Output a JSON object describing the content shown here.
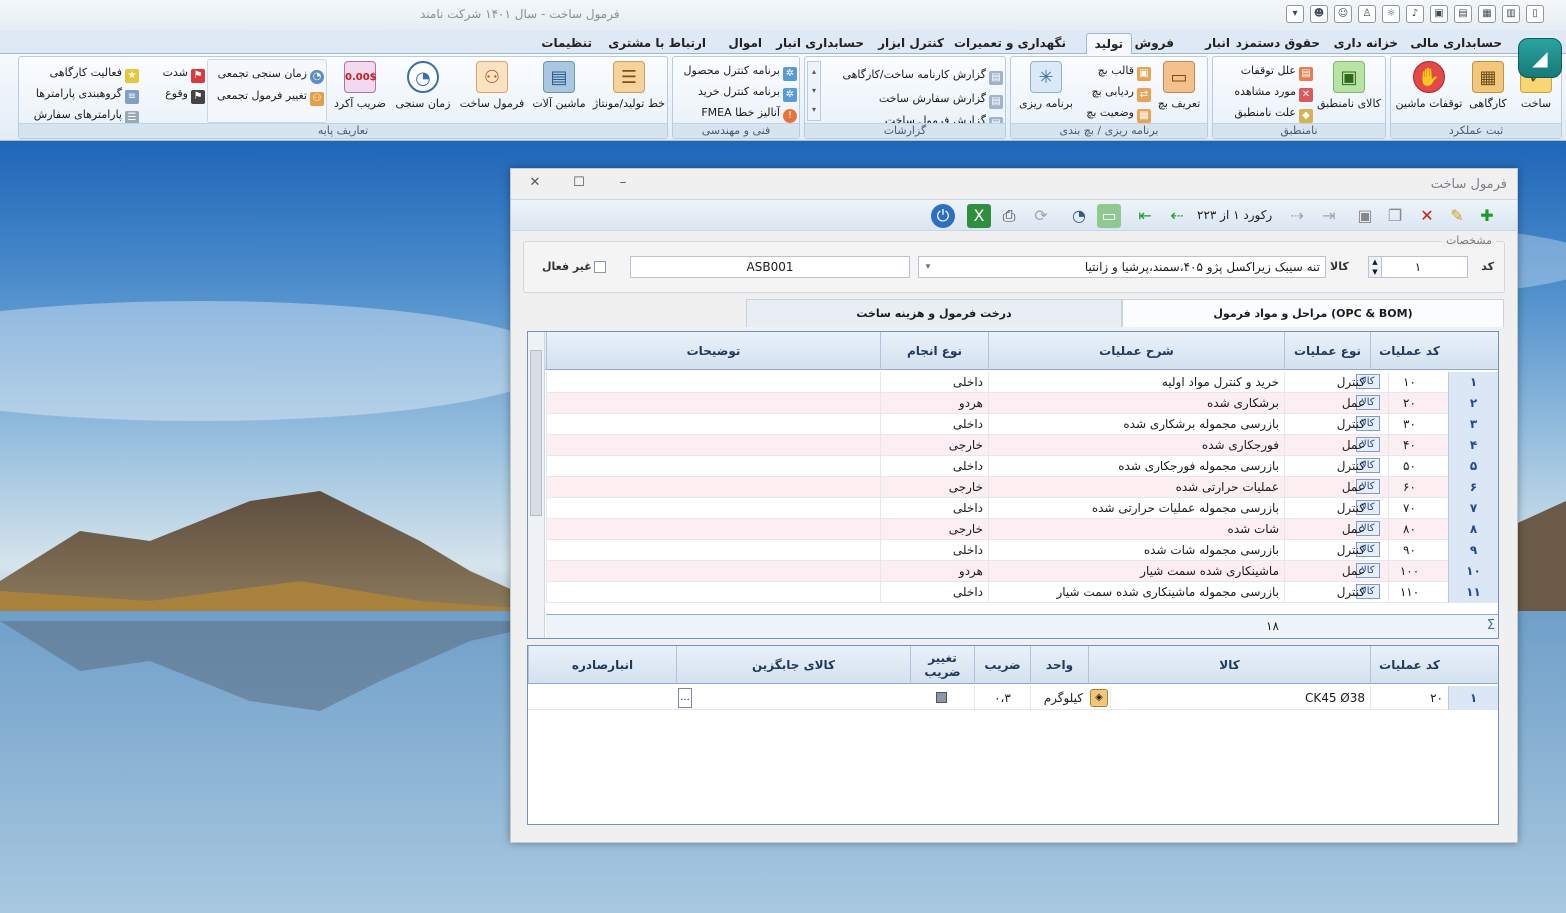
{
  "app": {
    "title": "فرمول ساخت - سال ۱۴۰۱ شرکت نامند"
  },
  "tabs": [
    "حسابداری مالی",
    "خزانه داری",
    "حقوق دستمزد",
    "انبار",
    "فروش",
    "تولید",
    "نگهداری و تعمیرات",
    "کنترل ابزار",
    "حسابداری انبار",
    "اموال",
    "ارتباط با مشتری",
    "تنظیمات"
  ],
  "active_tab": "تولید",
  "ribbon": {
    "groups": {
      "sabt": "ثبت عملکرد",
      "namontabegh": "نامنطبق",
      "barname": "برنامه ریزی / بچ بندی",
      "gozareshat": "گزارشات",
      "fanni": "فنی و مهندسی",
      "payeh": "تعاریف پایه"
    },
    "buttons": {
      "sakht": "ساخت",
      "kargahi": "کارگاهی",
      "tavaghofat": "توقفات ماشین",
      "kala_namontabegh": "کالای نامنطبق",
      "elal_tavaghofat": "علل توقفات",
      "mored_moshahede": "مورد مشاهده",
      "elat_namontabegh": "علت نامنطبق",
      "tarif_bach": "تعریف بچ",
      "ghaleb_bach": "قالب بچ",
      "radyabi_bach": "ردیابی بچ",
      "vaziat_bach": "وضعیت بچ",
      "barname_rizi": "برنامه ریزی",
      "gozaresh_karname": "گزارش کارنامه ساخت/کارگاهی",
      "gozaresh_sefaresh": "گزارش سفارش ساخت",
      "gozaresh_third": "گزارش فرمول ساخت",
      "barname_control_mahsool": "برنامه کنترل محصول",
      "barname_control_kharid": "برنامه کنترل خرید",
      "fmea": "آنالیز خطا FMEA",
      "khat_tolid": "خط تولید/مونتاژ",
      "mashin_alat": "ماشین آلات",
      "formool_sakht": "فرمول ساخت",
      "zaman_sanji": "زمان سنجی",
      "zarib_akord": "ضریب آکرد",
      "zarib_value": "0.00$",
      "zaman_sanji_tajamoei": "زمان سنجی تجمعی",
      "taghir_formool": "تغییر فرمول تجمعی",
      "faaliat_kargahi": "فعالیت کارگاهی",
      "gorooh_parametr": "گروهبندی پارامترها",
      "parametr_sefaresh": "پارامترهای سفارش",
      "shedat": "شدت",
      "vogho": "وقوع"
    }
  },
  "window": {
    "title": "فرمول ساخت",
    "record_info": "رکورد ۱ از ۲۲۳",
    "specs_legend": "مشخصات",
    "code_label": "کد",
    "code_value": "۱",
    "kala_label": "کالا",
    "kala_value": "تنه سیبک زیراکسل پژو ۴۰۵،سمند،پرشیا و زانتیا",
    "kala_code": "ASB001",
    "inactive_label": "غیر فعال",
    "tab_stages": "مراحل و مواد فرمول (OPC & BOM)",
    "tab_tree": "درخت فرمول و هزینه ساخت"
  },
  "ops_grid": {
    "headers": {
      "code": "کد عملیات",
      "type": "نوع عملیات",
      "desc": "شرح عملیات",
      "perform": "نوع انجام",
      "notes": "توضیحات"
    },
    "kala_btn": "کالا",
    "rows": [
      {
        "n": "۱",
        "code": "۱۰",
        "type": "کنترل",
        "desc": "خرید و کنترل مواد اولیه",
        "perform": "داخلی"
      },
      {
        "n": "۲",
        "code": "۲۰",
        "type": "عمل",
        "desc": "برشکاری شده",
        "perform": "هردو"
      },
      {
        "n": "۳",
        "code": "۳۰",
        "type": "کنترل",
        "desc": "بازرسی مجموله برشکاری شده",
        "perform": "داخلی"
      },
      {
        "n": "۴",
        "code": "۴۰",
        "type": "عمل",
        "desc": "فورجکاری شده",
        "perform": "خارجی"
      },
      {
        "n": "۵",
        "code": "۵۰",
        "type": "کنترل",
        "desc": "بازرسی مجموله فورجکاری شده",
        "perform": "داخلی"
      },
      {
        "n": "۶",
        "code": "۶۰",
        "type": "عمل",
        "desc": "عملیات حرارتی شده",
        "perform": "خارجی"
      },
      {
        "n": "۷",
        "code": "۷۰",
        "type": "کنترل",
        "desc": "بازرسی مجموله عملیات حرارتی شده",
        "perform": "داخلی"
      },
      {
        "n": "۸",
        "code": "۸۰",
        "type": "عمل",
        "desc": "شات شده",
        "perform": "خارجی"
      },
      {
        "n": "۹",
        "code": "۹۰",
        "type": "کنترل",
        "desc": "بازرسی مجموله شات شده",
        "perform": "داخلی"
      },
      {
        "n": "۱۰",
        "code": "۱۰۰",
        "type": "عمل",
        "desc": "ماشینکاری شده سمت شیار",
        "perform": "هردو"
      },
      {
        "n": "۱۱",
        "code": "۱۱۰",
        "type": "کنترل",
        "desc": "بازرسی مجموله ماشینکاری شده سمت شیار",
        "perform": "داخلی"
      }
    ],
    "footer_count": "۱۸",
    "sigma": "Σ"
  },
  "bom_grid": {
    "headers": {
      "code": "کد عملیات",
      "kala": "کالا",
      "unit": "واحد",
      "zarib": "ضریب",
      "taghir": "تغییر ضریب",
      "jaygozin": "کالای جابگزین",
      "anbar": "انبارصادره"
    },
    "row": {
      "n": "۱",
      "code": "۲۰",
      "kala": "CK45 Ø38",
      "unit": "کیلوگرم",
      "zarib": "۰،۳",
      "ellipsis": "..."
    }
  }
}
